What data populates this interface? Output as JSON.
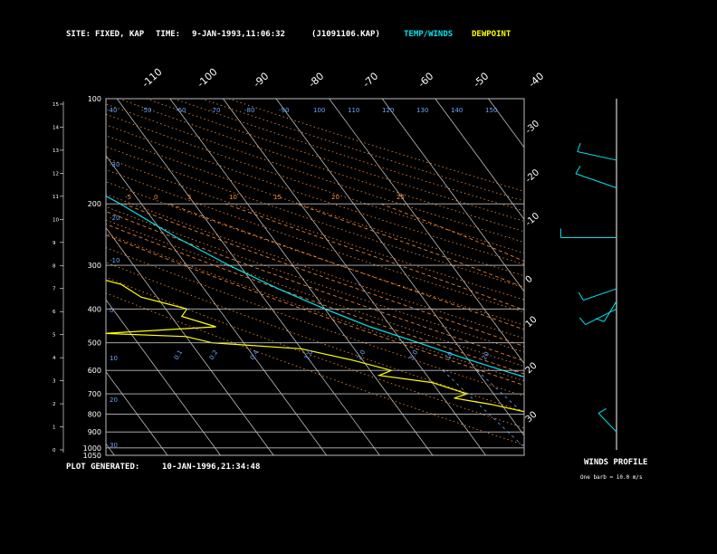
{
  "header": {
    "site_label": "SITE:",
    "site_value": "FIXED, KAP",
    "time_label": "TIME:",
    "time_value": "9-JAN-1993,11:06:32",
    "file_id": "(J1091106.KAP)",
    "legend_temp": "TEMP/WINDS",
    "legend_dew": "DEWPOINT"
  },
  "footer": {
    "generated_label": "PLOT GENERATED:",
    "generated_value": "10-JAN-1996,21:34:48",
    "winds_title": "WINDS PROFILE",
    "barb_note": "One barb = 10.0 m/s"
  },
  "colors": {
    "temp": "#00e5ee",
    "dew": "#ffff00",
    "grid": "#bdbdbd",
    "dry_adiabat": "#ff8c3a",
    "moist_adiabat": "#ff8c3a",
    "mixing_ratio": "#6aa6ff",
    "background": "#000000"
  },
  "chart_data": {
    "type": "line",
    "chart_kind": "skew-t log-p diagram",
    "pressure_levels": [
      100,
      200,
      300,
      400,
      500,
      600,
      700,
      800,
      900,
      1000,
      1050
    ],
    "pressure_labels": [
      "100",
      "200",
      "300",
      "400",
      "500",
      "600",
      "700",
      "800",
      "900",
      "1000",
      "1050"
    ],
    "ylim": [
      100,
      1050
    ],
    "height_km_ticks": [
      "15",
      "14",
      "13",
      "12",
      "11",
      "10",
      "9",
      "8",
      "7",
      "6",
      "5",
      "4",
      "3",
      "2",
      "1",
      "0"
    ],
    "top_isotherm_labels": [
      "-110",
      "-100",
      "-90",
      "-80",
      "-70",
      "-60",
      "-50",
      "-40"
    ],
    "right_isotherm_labels": [
      "-30",
      "-20",
      "-10",
      "0",
      "10",
      "20",
      "30"
    ],
    "dry_adiabat_labels": [
      "-40",
      "-30",
      "-20",
      "-10",
      "0",
      "10",
      "20",
      "30",
      "40",
      "50",
      "60",
      "70",
      "80",
      "90",
      "100",
      "110",
      "120",
      "130",
      "140",
      "150"
    ],
    "moist_adiabat_labels": [
      "-5",
      "0",
      "5",
      "10",
      "15",
      "20",
      "25"
    ],
    "mixing_ratio_labels": [
      "0.1",
      "0.2",
      "0.4",
      "1.0",
      "2.0",
      "5.0",
      "10",
      "20"
    ],
    "series": [
      {
        "name": "TEMP/WINDS",
        "points": [
          [
            100,
            -95
          ],
          [
            150,
            -93
          ],
          [
            200,
            -84
          ],
          [
            250,
            -78
          ],
          [
            300,
            -72
          ],
          [
            350,
            -66
          ],
          [
            400,
            -60
          ],
          [
            450,
            -54
          ],
          [
            500,
            -47
          ],
          [
            550,
            -41
          ],
          [
            600,
            -35
          ],
          [
            650,
            -29
          ],
          [
            700,
            -24
          ],
          [
            750,
            -18
          ],
          [
            800,
            -13
          ],
          [
            850,
            -9
          ],
          [
            900,
            -5
          ],
          [
            950,
            -1
          ],
          [
            1000,
            3
          ],
          [
            1030,
            6
          ]
        ]
      },
      {
        "name": "DEWPOINT",
        "points": [
          [
            100,
            -106
          ],
          [
            150,
            -104
          ],
          [
            180,
            -99
          ],
          [
            200,
            -98
          ],
          [
            220,
            -99
          ],
          [
            250,
            -104
          ],
          [
            280,
            -107
          ],
          [
            310,
            -103
          ],
          [
            340,
            -95
          ],
          [
            370,
            -93
          ],
          [
            400,
            -86
          ],
          [
            420,
            -88
          ],
          [
            450,
            -83
          ],
          [
            470,
            -105
          ],
          [
            480,
            -90
          ],
          [
            500,
            -86
          ],
          [
            520,
            -70
          ],
          [
            560,
            -62
          ],
          [
            600,
            -56
          ],
          [
            620,
            -59
          ],
          [
            650,
            -50
          ],
          [
            700,
            -45
          ],
          [
            720,
            -48
          ],
          [
            750,
            -42
          ],
          [
            800,
            -35
          ],
          [
            820,
            -27
          ],
          [
            860,
            -22
          ],
          [
            900,
            -17
          ],
          [
            930,
            -15
          ],
          [
            960,
            -16
          ],
          [
            990,
            -12
          ],
          [
            1030,
            -3
          ]
        ]
      }
    ],
    "winds_profile": [
      {
        "p": 150,
        "dir": 290,
        "speed": 15
      },
      {
        "p": 180,
        "dir": 300,
        "speed": 20
      },
      {
        "p": 250,
        "dir": 270,
        "speed": 28
      },
      {
        "p": 350,
        "dir": 240,
        "speed": 12
      },
      {
        "p": 380,
        "dir": 200,
        "speed": 10
      },
      {
        "p": 400,
        "dir": 230,
        "speed": 14
      },
      {
        "p": 900,
        "dir": 330,
        "speed": 10
      }
    ]
  }
}
